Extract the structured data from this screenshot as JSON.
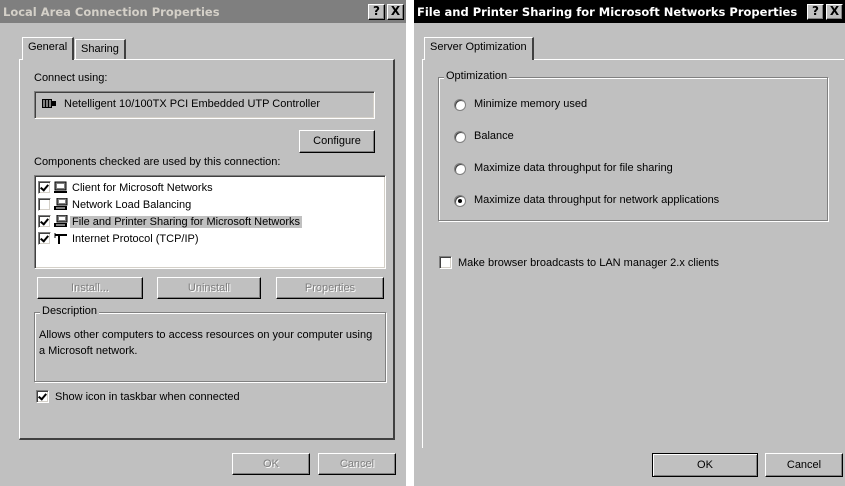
{
  "left_window": {
    "title": "Local Area Connection Properties",
    "help_btn": "?",
    "close_btn": "X",
    "tabs": [
      {
        "label": "General"
      },
      {
        "label": "Sharing"
      }
    ],
    "connect_using_label": "Connect using:",
    "adapter_name": "Netelligent 10/100TX PCI Embedded UTP Controller",
    "configure_label": "Configure",
    "components_label": "Components checked are used by this connection:",
    "components": [
      {
        "label": "Client for Microsoft Networks",
        "checked": true,
        "icon": "network-client-icon"
      },
      {
        "label": "Network Load Balancing",
        "checked": false,
        "icon": "network-service-icon"
      },
      {
        "label": "File and Printer Sharing for Microsoft Networks",
        "checked": true,
        "selected": true,
        "icon": "network-service-icon"
      },
      {
        "label": "Internet Protocol (TCP/IP)",
        "checked": true,
        "icon": "protocol-icon"
      }
    ],
    "install_label": "Install...",
    "uninstall_label": "Uninstall",
    "properties_label": "Properties",
    "description_title": "Description",
    "description_text": "Allows other computers to access resources on your computer using a Microsoft network.",
    "show_icon_label": "Show icon in taskbar when connected",
    "show_icon_checked": true,
    "ok_label": "OK",
    "cancel_label": "Cancel"
  },
  "right_window": {
    "title": "File and Printer Sharing for Microsoft Networks Properties",
    "help_btn": "?",
    "close_btn": "X",
    "tab_label": "Server Optimization",
    "group_title": "Optimization",
    "options": [
      {
        "label": "Minimize memory used",
        "selected": false
      },
      {
        "label": "Balance",
        "selected": false
      },
      {
        "label": "Maximize data throughput for file sharing",
        "selected": false
      },
      {
        "label": "Maximize data throughput for network applications",
        "selected": true
      }
    ],
    "browser_broadcast_label": "Make browser broadcasts to LAN manager 2.x clients",
    "browser_broadcast_checked": false,
    "ok_label": "OK",
    "cancel_label": "Cancel"
  },
  "colors": {
    "dialog_face": "#c0c0c0",
    "inactive_title": "#7f7f7f",
    "active_title": "#000000"
  }
}
